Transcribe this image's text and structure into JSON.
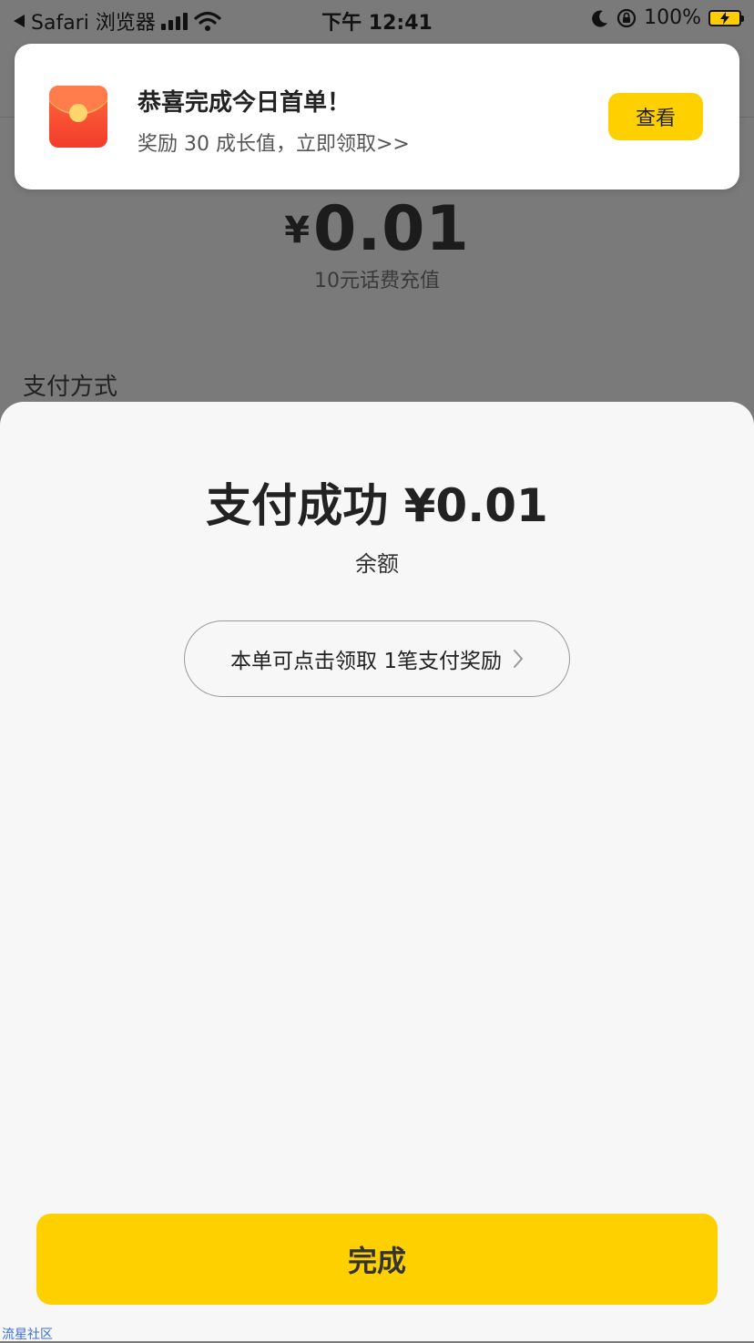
{
  "status_bar": {
    "back_app": "Safari 浏览器",
    "time": "下午 12:41",
    "battery_percent": "100%"
  },
  "background_page": {
    "currency_symbol": "¥",
    "amount": "0.01",
    "product": "10元话费充值",
    "payment_method_label": "支付方式"
  },
  "banner": {
    "title": "恭喜完成今日首单！",
    "subtitle": "奖励 30 成长值，立即领取>>",
    "button_label": "查看"
  },
  "sheet": {
    "title": "支付成功 ¥0.01",
    "method": "余额",
    "reward_text": "本单可点击领取 1笔支付奖励",
    "done_label": "完成"
  },
  "watermark": "流星社区",
  "colors": {
    "accent": "#ffd000",
    "overlay": "#7a7a7a",
    "sheet_bg": "#f7f7f7"
  }
}
